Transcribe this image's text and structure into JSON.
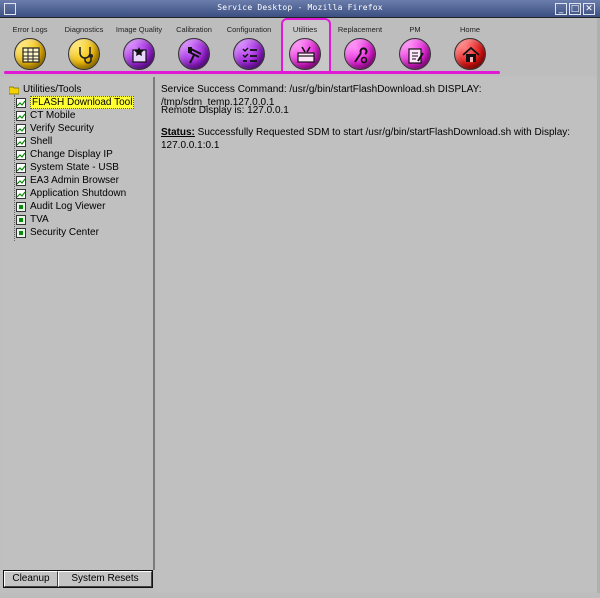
{
  "window": {
    "title": "Service Desktop - Mozilla Firefox",
    "min_glyph": "_",
    "max_glyph": "□",
    "close_glyph": "✕"
  },
  "toolbar": {
    "buttons": [
      {
        "label": "Error Logs",
        "color": "#f0b800",
        "icon": "clipboard-grid-icon"
      },
      {
        "label": "Diagnostics",
        "color": "#f0b800",
        "icon": "stethoscope-icon"
      },
      {
        "label": "Image Quality",
        "color": "#9a1fd8",
        "icon": "image-star-icon"
      },
      {
        "label": "Calibration",
        "color": "#9a1fd8",
        "icon": "caliper-icon"
      },
      {
        "label": "Configuration",
        "color": "#9a1fd8",
        "icon": "checklist-icon"
      },
      {
        "label": "Utilities",
        "color": "#e41bd7",
        "icon": "toolbox-icon",
        "active": true
      },
      {
        "label": "Replacement",
        "color": "#e41bd7",
        "icon": "wrench-icon"
      },
      {
        "label": "PM",
        "color": "#e41bd7",
        "icon": "clipboard-wrench-icon"
      },
      {
        "label": "Home",
        "color": "#e41212",
        "icon": "home-icon"
      }
    ],
    "highlight_color": "#e01ad4"
  },
  "tree": {
    "root": "Utilities/Tools",
    "items": [
      {
        "label": "FLASH Download Tool",
        "selected": true,
        "icon": "chart-page-icon"
      },
      {
        "label": "CT Mobile",
        "icon": "chart-page-icon"
      },
      {
        "label": "Verify Security",
        "icon": "chart-page-icon"
      },
      {
        "label": "Shell",
        "icon": "chart-page-icon"
      },
      {
        "label": "Change Display IP",
        "icon": "chart-page-icon"
      },
      {
        "label": "System State - USB",
        "icon": "chart-page-icon"
      },
      {
        "label": "EA3 Admin Browser",
        "icon": "chart-page-icon"
      },
      {
        "label": "Application Shutdown",
        "icon": "chart-page-icon"
      },
      {
        "label": "Audit Log Viewer",
        "icon": "document-icon"
      },
      {
        "label": "TVA",
        "icon": "document-icon"
      },
      {
        "label": "Security Center",
        "icon": "document-icon"
      }
    ]
  },
  "bottom_buttons": {
    "cleanup": "Cleanup",
    "system_resets": "System Resets"
  },
  "main": {
    "command_line": "Service Success Command: /usr/g/bin/startFlashDownload.sh DISPLAY: /tmp/sdm_temp.127.0.0.1",
    "remote_display": "Remote Display is: 127.0.0.1",
    "status_label": "Status:",
    "status_text_1": " Successfully Requested SDM to start /usr/g/bin/startFlashDownload.sh with Display:",
    "status_text_2": "127.0.0.1:0.1"
  }
}
